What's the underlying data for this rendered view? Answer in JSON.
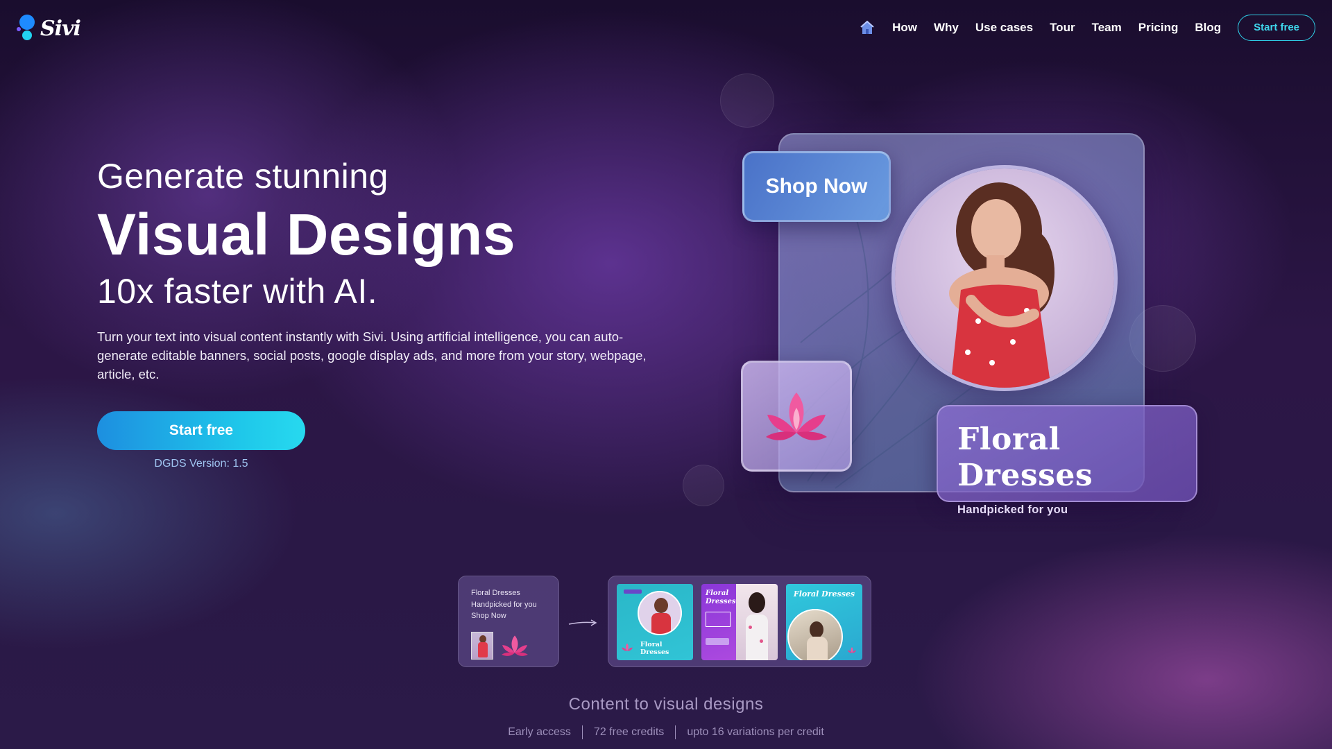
{
  "header": {
    "logo_text": "Sivi",
    "home_icon": "home-icon",
    "nav": [
      "How",
      "Why",
      "Use cases",
      "Tour",
      "Team",
      "Pricing",
      "Blog"
    ],
    "cta": "Start free"
  },
  "hero": {
    "line1": "Generate stunning",
    "line2": "Visual Designs",
    "line3": "10x faster with AI.",
    "description": "Turn your text into visual content instantly with Sivi. Using artificial intelligence, you can auto-generate editable banners, social posts, google display ads, and more from your story, webpage, article, etc.",
    "cta": "Start free",
    "version": "DGDS Version: 1.5"
  },
  "art": {
    "shop_button": "Shop Now",
    "title": "Floral Dresses",
    "subtitle": "Handpicked for you",
    "lotus_icon": "lotus-icon"
  },
  "demo": {
    "input_lines": [
      "Floral Dresses",
      "Handpicked for you",
      "Shop Now"
    ],
    "thumb_titles": [
      "Floral Dresses",
      "Floral Dresses",
      "Floral Dresses"
    ],
    "arrow_icon": "arrow-right-icon"
  },
  "footer": {
    "title": "Content to visual designs",
    "meta": [
      "Early access",
      "72 free credits",
      "upto 16 variations per credit"
    ]
  },
  "colors": {
    "accent": "#22d3f0",
    "cta_start": "#1d8fe0",
    "cta_end": "#27d9ef",
    "background": "#2c1646"
  }
}
